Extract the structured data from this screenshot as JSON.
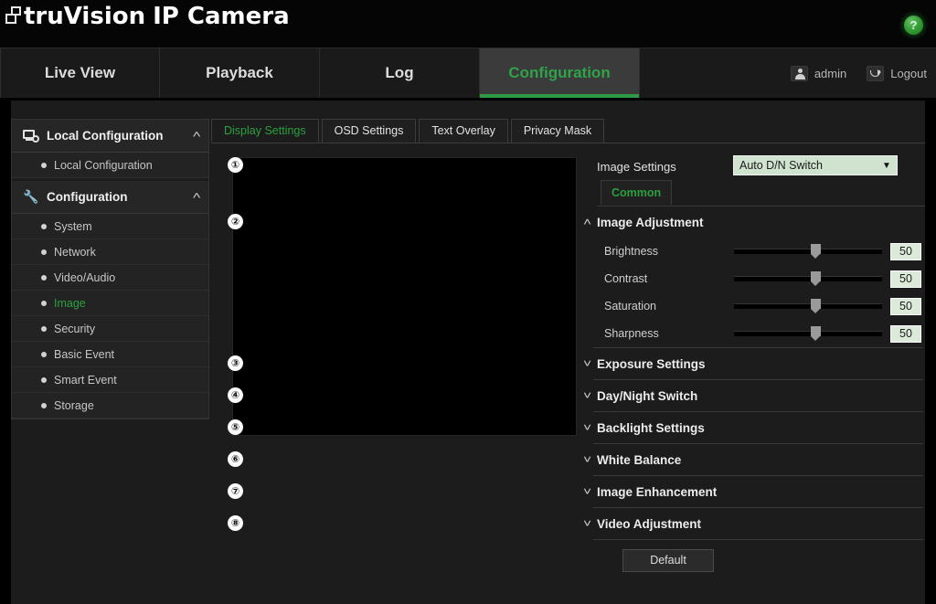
{
  "brand": {
    "title_part1": "truVision",
    "title_part2": "IP Camera",
    "logo_icon": "stacked-squares-icon",
    "help_icon": "?"
  },
  "nav": {
    "tabs": [
      {
        "label": "Live View",
        "active": false
      },
      {
        "label": "Playback",
        "active": false
      },
      {
        "label": "Log",
        "active": false
      },
      {
        "label": "Configuration",
        "active": true
      }
    ],
    "user": {
      "label": "admin",
      "icon": "user-icon"
    },
    "logout": {
      "label": "Logout",
      "icon": "logout-icon"
    }
  },
  "sidebar": {
    "groups": [
      {
        "label": "Local Configuration",
        "icon": "monitor-gear-icon",
        "chevron": "˄",
        "items": [
          {
            "label": "Local Configuration",
            "active": false
          }
        ]
      },
      {
        "label": "Configuration",
        "icon": "wrench-icon",
        "chevron": "˄",
        "items": [
          {
            "label": "System",
            "active": false
          },
          {
            "label": "Network",
            "active": false
          },
          {
            "label": "Video/Audio",
            "active": false
          },
          {
            "label": "Image",
            "active": true
          },
          {
            "label": "Security",
            "active": false
          },
          {
            "label": "Basic Event",
            "active": false
          },
          {
            "label": "Smart Event",
            "active": false
          },
          {
            "label": "Storage",
            "active": false
          }
        ]
      }
    ]
  },
  "content": {
    "tabs": [
      {
        "label": "Display Settings",
        "active": true
      },
      {
        "label": "OSD Settings",
        "active": false
      },
      {
        "label": "Text Overlay",
        "active": false
      },
      {
        "label": "Privacy Mask",
        "active": false
      }
    ],
    "preview": {
      "name": "live-video-preview"
    },
    "image_settings": {
      "callout": "①",
      "label": "Image Settings",
      "select_value": "Auto D/N Switch",
      "select_arrow": "▼",
      "common_tab": "Common"
    },
    "image_adjustment": {
      "callout": "②",
      "caret": "˄",
      "title": "Image Adjustment",
      "sliders": [
        {
          "label": "Brightness",
          "value": "50",
          "percent": 55
        },
        {
          "label": "Contrast",
          "value": "50",
          "percent": 55
        },
        {
          "label": "Saturation",
          "value": "50",
          "percent": 55
        },
        {
          "label": "Sharpness",
          "value": "50",
          "percent": 55
        }
      ]
    },
    "sections": [
      {
        "callout": "③",
        "caret": "˅",
        "title": "Exposure Settings"
      },
      {
        "callout": "④",
        "caret": "˅",
        "title": "Day/Night Switch"
      },
      {
        "callout": "⑤",
        "caret": "˅",
        "title": "Backlight Settings"
      },
      {
        "callout": "⑥",
        "caret": "˅",
        "title": "White Balance"
      },
      {
        "callout": "⑦",
        "caret": "˅",
        "title": "Image Enhancement"
      },
      {
        "callout": "⑧",
        "caret": "˅",
        "title": "Video Adjustment"
      }
    ],
    "default_button": "Default"
  },
  "colors": {
    "accent_green": "#2aa03f",
    "tab_underline": "#2e9c45",
    "panel_bg": "#1c1c1c",
    "sidebar_bg": "#232323",
    "select_bg": "#cfe3cf"
  }
}
